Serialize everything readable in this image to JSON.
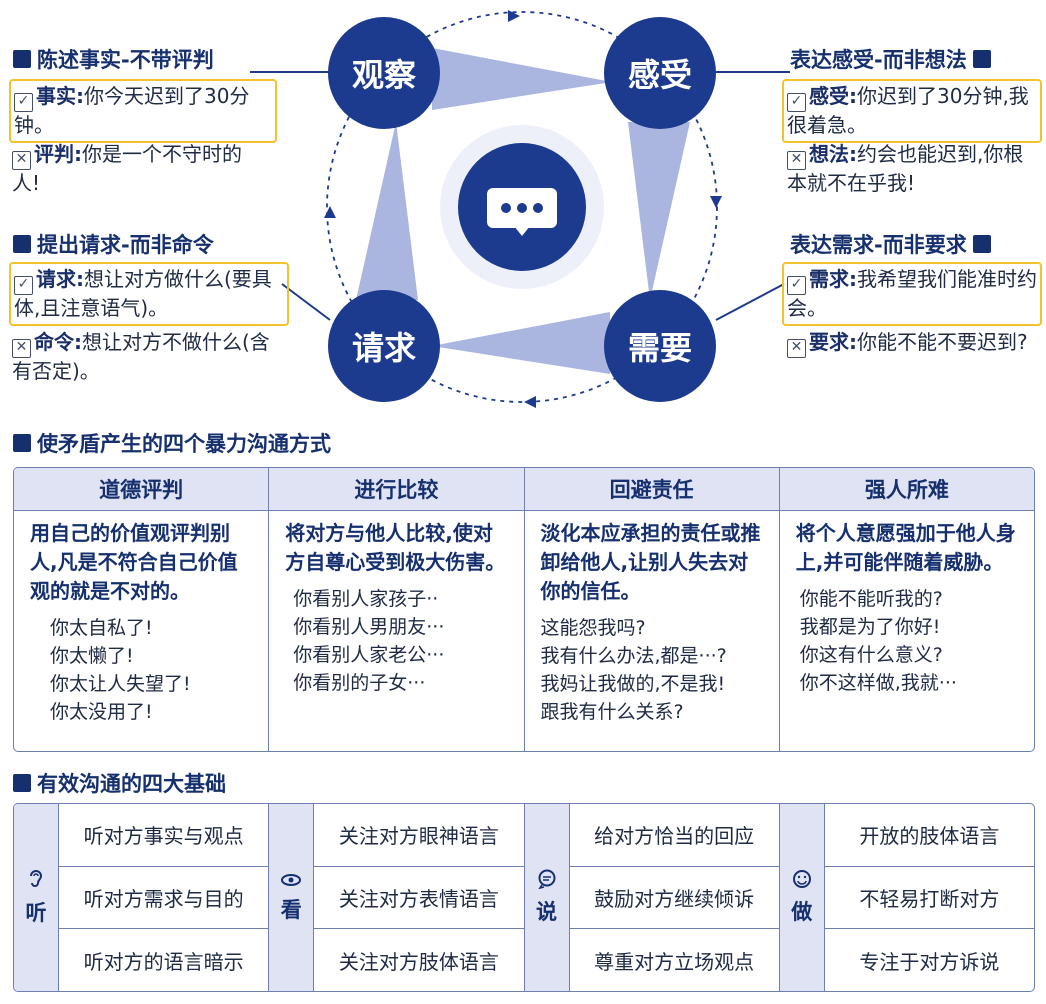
{
  "center_icon": "chat-bubble-icon",
  "nodes": {
    "observe": "观察",
    "feel": "感受",
    "request": "请求",
    "need": "需要"
  },
  "left_top": {
    "title": "陈述事实-不带评判",
    "yes_label": "事实:",
    "yes_text": "你今天迟到了30分钟。",
    "no_label": "评判:",
    "no_text": "你是一个不守时的人!"
  },
  "left_bottom": {
    "title": "提出请求-而非命令",
    "yes_label": "请求:",
    "yes_text": "想让对方做什么(要具体,且注意语气)。",
    "no_label": "命令:",
    "no_text": "想让对方不做什么(含有否定)。"
  },
  "right_top": {
    "title": "表达感受-而非想法",
    "yes_label": "感受:",
    "yes_text": "你迟到了30分钟,我很着急。",
    "no_label": "想法:",
    "no_text": "约会也能迟到,你根本就不在乎我!"
  },
  "right_bottom": {
    "title": "表达需求-而非要求",
    "yes_label": "需求:",
    "yes_text": "我希望我们能准时约会。",
    "no_label": "要求:",
    "no_text": "你能不能不要迟到?"
  },
  "violent": {
    "title": "使矛盾产生的四个暴力沟通方式",
    "columns": [
      {
        "header": "道德评判",
        "desc": "用自己的价值观评判别人,凡是不符合自己价值观的就是不对的。",
        "examples": [
          "你太自私了!",
          "你太懒了!",
          "你太让人失望了!",
          "你太没用了!"
        ]
      },
      {
        "header": "进行比较",
        "desc": "将对方与他人比较,使对方自尊心受到极大伤害。",
        "examples": [
          "你看别人家孩子··",
          "你看别人男朋友···",
          "你看别人家老公···",
          "你看别的子女···"
        ]
      },
      {
        "header": "回避责任",
        "desc": "淡化本应承担的责任或推卸给他人,让别人失去对你的信任。",
        "examples": [
          "这能怨我吗?",
          "我有什么办法,都是···?",
          "我妈让我做的,不是我!",
          "跟我有什么关系?"
        ]
      },
      {
        "header": "强人所难",
        "desc": "将个人意愿强加于他人身上,并可能伴随着威胁。",
        "examples": [
          "你能不能听我的?",
          "我都是为了你好!",
          "你这有什么意义?",
          "你不这样做,我就···"
        ]
      }
    ]
  },
  "basics": {
    "title": "有效沟通的四大基础",
    "groups": [
      {
        "label": "听",
        "icon": "ear-icon",
        "items": [
          "听对方事实与观点",
          "听对方需求与目的",
          "听对方的语言暗示"
        ]
      },
      {
        "label": "看",
        "icon": "eye-icon",
        "items": [
          "关注对方眼神语言",
          "关注对方表情语言",
          "关注对方肢体语言"
        ]
      },
      {
        "label": "说",
        "icon": "speech-bubble-icon",
        "items": [
          "给对方恰当的回应",
          "鼓励对方继续倾诉",
          "尊重对方立场观点"
        ]
      },
      {
        "label": "做",
        "icon": "smiley-icon",
        "items": [
          "开放的肢体语言",
          "不轻易打断对方",
          "专注于对方诉说"
        ]
      }
    ]
  }
}
